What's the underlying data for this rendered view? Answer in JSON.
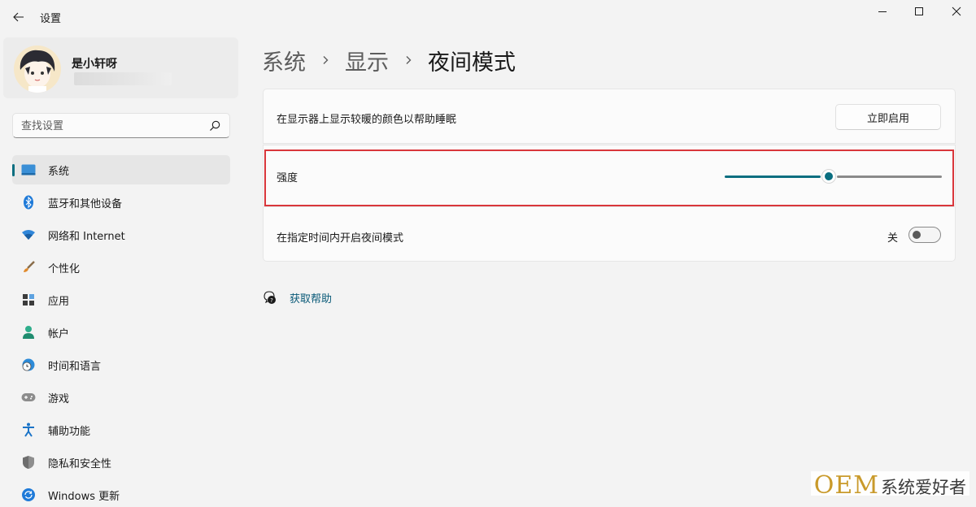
{
  "window": {
    "title": "设置",
    "controls": [
      "minimize-icon",
      "maximize-icon",
      "close-icon"
    ]
  },
  "profile": {
    "name": "是小轩呀"
  },
  "search": {
    "placeholder": "查找设置",
    "value": ""
  },
  "nav": {
    "items": [
      {
        "label": "系统",
        "icon": "system-icon",
        "active": true
      },
      {
        "label": "蓝牙和其他设备",
        "icon": "bluetooth-icon"
      },
      {
        "label": "网络和 Internet",
        "icon": "wifi-icon"
      },
      {
        "label": "个性化",
        "icon": "brush-icon"
      },
      {
        "label": "应用",
        "icon": "apps-icon"
      },
      {
        "label": "帐户",
        "icon": "account-icon"
      },
      {
        "label": "时间和语言",
        "icon": "globe-clock-icon"
      },
      {
        "label": "游戏",
        "icon": "gamepad-icon"
      },
      {
        "label": "辅助功能",
        "icon": "accessibility-icon"
      },
      {
        "label": "隐私和安全性",
        "icon": "shield-icon"
      },
      {
        "label": "Windows 更新",
        "icon": "update-icon"
      }
    ]
  },
  "breadcrumb": {
    "items": [
      "系统",
      "显示",
      "夜间模式"
    ]
  },
  "night_light": {
    "description": "在显示器上显示较暖的颜色以帮助睡眠",
    "enable_button": "立即启用",
    "strength_label": "强度",
    "strength_value": 0.48,
    "schedule_label": "在指定时间内开启夜间模式",
    "schedule_state": "关",
    "schedule_on": false
  },
  "help": {
    "label": "获取帮助"
  },
  "watermark": {
    "brand": "OEM",
    "text": "系统爱好者"
  },
  "colors": {
    "accent": "#0a6e80",
    "highlight_border": "#d9363b",
    "background": "#f3f3f3"
  }
}
